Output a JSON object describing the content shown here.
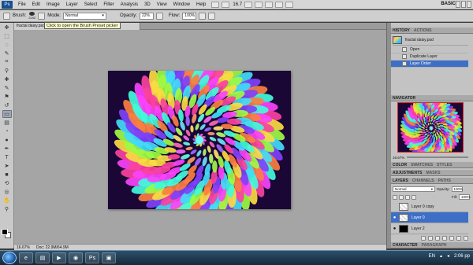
{
  "menu": {
    "logo": "Ps",
    "items": [
      "File",
      "Edit",
      "Image",
      "Layer",
      "Select",
      "Filter",
      "Analysis",
      "3D",
      "View",
      "Window",
      "Help"
    ],
    "zoom": "16.7",
    "workspace": "BASIC"
  },
  "options_bar": {
    "brush_label": "Brush:",
    "brush_size": "2192",
    "mode_label": "Mode:",
    "mode_value": "Normal",
    "opacity_label": "Opacity:",
    "opacity_value": "22%",
    "flow_label": "Flow:",
    "flow_value": "100%"
  },
  "tooltip": "Click to open the Brush Preset picker",
  "document_tab": "fractal daisy.psd @ 16.7% (Layer 0, RGB/8) *",
  "status": {
    "zoom": "16.67%",
    "doc": "Doc: 22.9M/64.9M"
  },
  "history": {
    "tabs": [
      "HISTORY",
      "ACTIONS"
    ],
    "snapshot": "fractal daisy.psd",
    "steps": [
      "Open",
      "Duplicate Layer",
      "Layer Order"
    ],
    "selected_index": 2
  },
  "navigator": {
    "tabs": [
      "NAVIGATOR"
    ],
    "zoom": "16.67%"
  },
  "color_panel": {
    "tabs": [
      "COLOR",
      "SWATCHES",
      "STYLES"
    ]
  },
  "adjust_panel": {
    "tabs": [
      "ADJUSTMENTS",
      "MASKS"
    ]
  },
  "layers": {
    "tabs": [
      "LAYERS",
      "CHANNELS",
      "PATHS"
    ],
    "blend_mode": "Normal",
    "opacity_label": "Opacity:",
    "opacity_value": "100%",
    "fill_label": "Fill:",
    "fill_value": "100%",
    "rows": [
      {
        "name": "Layer 0 copy",
        "visible": false,
        "thumb": "check",
        "selected": false
      },
      {
        "name": "Layer 0",
        "visible": true,
        "thumb": "check",
        "selected": true
      },
      {
        "name": "Layer 2",
        "visible": true,
        "thumb": "black",
        "selected": false
      }
    ]
  },
  "bottom_tabs": [
    "CHARACTER",
    "PARAGRAPH"
  ],
  "taskbar": {
    "lang": "EN",
    "time": "2:06 pp"
  },
  "colors": {
    "selection": "#3d6fc7",
    "canvas_bg": "#a5a5a5",
    "artwork_bg": "#1a0736"
  }
}
